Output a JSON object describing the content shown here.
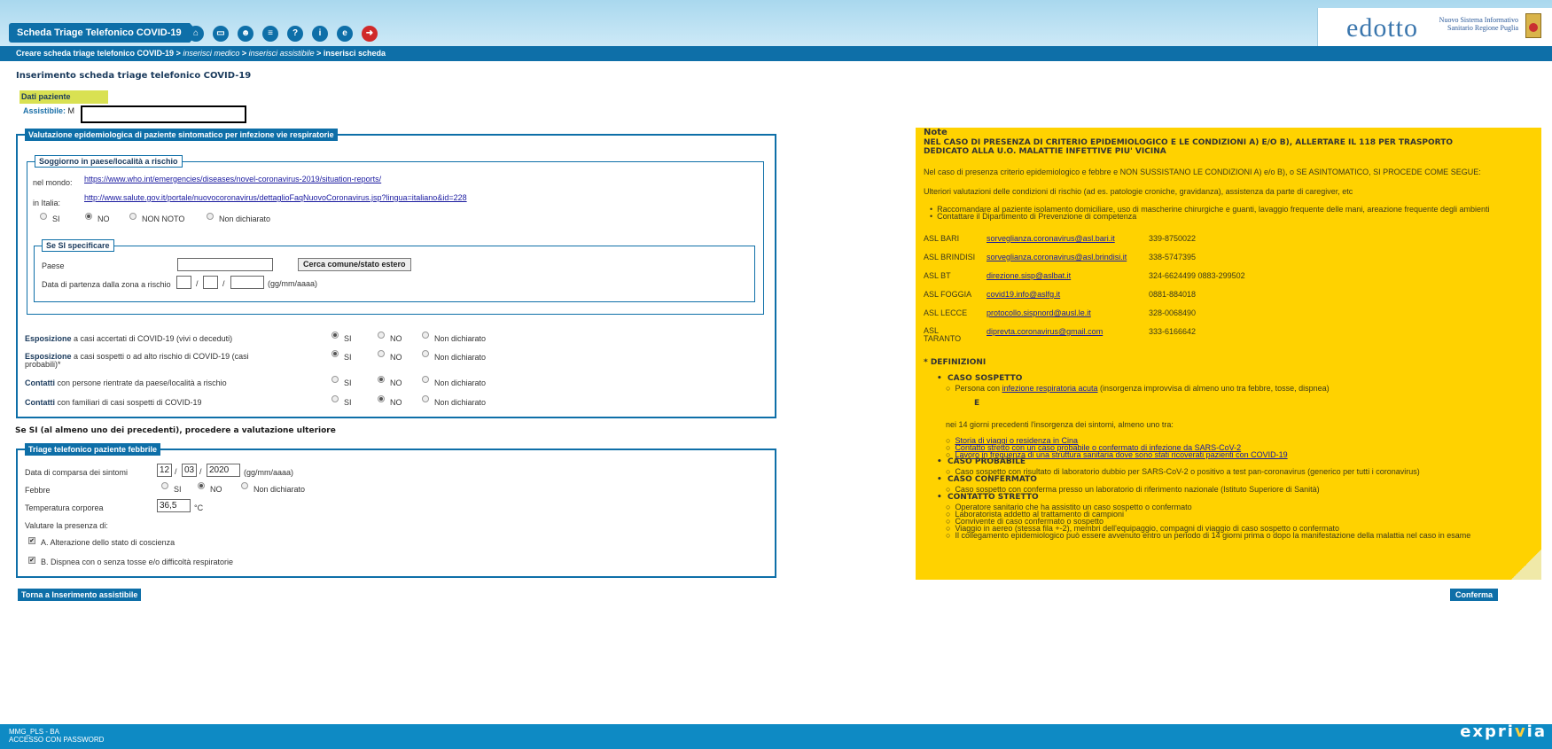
{
  "header": {
    "app_title": "Scheda Triage Telefonico COVID-19",
    "nav_icons": [
      "home-icon",
      "folder-icon",
      "users-icon",
      "document-icon",
      "help-icon",
      "info-icon",
      "sheet-icon",
      "exit-icon"
    ],
    "logo": "edotto",
    "regione": "Nuovo Sistema Informativo Sanitario Regione Puglia"
  },
  "breadcrumb": {
    "item1": "Creare scheda triage telefonico COVID-19",
    "item2": "inserisci medico",
    "item3": "inserisci assistibile",
    "item4": "inserisci scheda",
    "sep": " > "
  },
  "page_title": "Inserimento scheda triage telefonico COVID-19",
  "dati": {
    "title": "Dati paziente",
    "assistibile_label": "Assistibile:",
    "assistibile_value": "M"
  },
  "valutazione": {
    "title": "Valutazione epidemiologica di paziente sintomatico per infezione vie respiratorie",
    "soggiorno": {
      "title": "Soggiorno in paese/località a rischio",
      "nel_mondo": "nel mondo:",
      "link_mondo": "https://www.who.int/emergencies/diseases/novel-coronavirus-2019/situation-reports/",
      "in_italia": "in Italia:",
      "link_italia": "http://www.salute.gov.it/portale/nuovocoronavirus/dettaglioFaqNuovoCoronavirus.jsp?lingua=italiano&id=228",
      "opt_si": "SI",
      "opt_no": "NO",
      "opt_non_noto": "NON NOTO",
      "opt_non_dich": "Non dichiarato"
    },
    "se_si": {
      "title": "Se SI specificare",
      "paese": "Paese",
      "cerca": "Cerca comune/stato estero",
      "data_partenza": "Data di partenza dalla zona a rischio",
      "date_fmt": "(gg/mm/aaaa)",
      "sep": "/"
    },
    "rows": [
      {
        "bold": "Esposizione",
        "text": " a casi accertati di COVID-19 (vivi o deceduti)"
      },
      {
        "bold": "Esposizione",
        "text": " a casi sospetti o ad alto rischio di COVID-19 (casi",
        "text2": "probabili)*"
      },
      {
        "bold": "Contatti",
        "text": " con persone rientrate da paese/località a rischio"
      },
      {
        "bold": "Contatti",
        "text": " con familiari di casi sospetti di COVID-19"
      }
    ],
    "opt_si": "SI",
    "opt_no": "NO",
    "opt_non_dich": "Non dichiarato"
  },
  "se_si_note": "Se SI (al almeno uno dei precedenti), procedere a valutazione ulteriore",
  "triage": {
    "title": "Triage telefonico paziente febbrile",
    "data_comparsa": "Data di comparsa dei sintomi",
    "day": "12",
    "month": "03",
    "year": "2020",
    "date_fmt": "(gg/mm/aaaa)",
    "febbre": "Febbre",
    "opt_si": "SI",
    "opt_no": "NO",
    "opt_non_dich": "Non dichiarato",
    "temp_label": "Temperatura corporea",
    "temp_value": "36,5",
    "temp_unit": "°C",
    "valutare": "Valutare la presenza di:",
    "check_a": "A. Alterazione dello stato di coscienza",
    "check_b": "B. Dispnea con o senza tosse e/o difficoltà respiratorie"
  },
  "buttons": {
    "torna": "Torna a Inserimento assistibile",
    "conferma": "Conferma"
  },
  "notes": {
    "title": "Note",
    "alert1": "NEL CASO DI PRESENZA DI CRITERIO EPIDEMIOLOGICO E LE CONDIZIONI A) E/O B), ALLERTARE IL 118 PER TRASPORTO",
    "alert2": "DEDICATO ALLA U.O. MALATTIE INFETTIVE PIU' VICINA",
    "line1": "Nel caso di presenza criterio epidemiologico e febbre e NON SUSSISTANO LE CONDIZIONI A) e/o B), o SE ASINTOMATICO, SI PROCEDE COME SEGUE:",
    "line2": "Ulteriori valutazioni delle condizioni di rischio (ad es. patologie croniche, gravidanza), assistenza da parte di caregiver, etc",
    "bullet1": "Raccomandare al paziente isolamento domiciliare, uso di mascherine chirurgiche e guanti, lavaggio frequente delle mani, areazione frequente degli ambienti",
    "bullet2": "Contattare il Dipartimento di Prevenzione di competenza",
    "asl": [
      {
        "name": "ASL BARI",
        "email": "sorveglianza.coronavirus@asl.bari.it",
        "phone": "339-8750022"
      },
      {
        "name": "ASL BRINDISI",
        "email": "sorveglianza.coronavirus@asl.brindisi.it",
        "phone": "338-5747395"
      },
      {
        "name": "ASL BT",
        "email": "direzione.sisp@aslbat.it",
        "phone": "324-6624499 0883-299502"
      },
      {
        "name": "ASL FOGGIA",
        "email": "covid19.info@aslfg.it",
        "phone": "0881-884018"
      },
      {
        "name": "ASL LECCE",
        "email": "protocollo.sispnord@ausl.le.it",
        "phone": "328-0068490"
      },
      {
        "name": "ASL",
        "name2": "TARANTO",
        "email": "diprevta.coronavirus@gmail.com",
        "phone": "333-6166642"
      }
    ],
    "def_title": "* DEFINIZIONI",
    "caso_sospetto": "CASO SOSPETTO",
    "cs1a": "Persona con ",
    "cs1link": "infezione respiratoria acuta",
    "cs1b": " (insorgenza improvvisa di almeno uno tra febbre, tosse, dispnea)",
    "cs_e": "E",
    "cs2": "nei 14 giorni precedenti l'insorgenza dei sintomi, almeno uno tra:",
    "cs_a": "Storia di viaggi o residenza in Cina",
    "cs_b": "Contatto stretto con un caso probabile o confermato di infezione da SARS-CoV-2",
    "cs_c": "Lavoro in frequenza di una struttura sanitaria dove sono stati ricoverati pazienti con COVID-19",
    "caso_probabile": "CASO PROBABILE",
    "cp1": "Caso sospetto con risultato di laboratorio dubbio per SARS-CoV-2 o positivo a test pan-coronavirus (generico per tutti i coronavirus)",
    "caso_confermato": "CASO CONFERMATO",
    "cc1": "Caso sospetto con conferma presso un laboratorio di riferimento nazionale (Istituto Superiore di Sanità)",
    "contatto_stretto": "CONTATTO STRETTO",
    "ct1": "Operatore sanitario che ha assistito un caso sospetto o confermato",
    "ct2": "Laboratorista addetto al trattamento di campioni",
    "ct3": "Convivente di caso confermato o sospetto",
    "ct4": "Viaggio in aereo (stessa fila +-2), membri dell'equipaggio, compagni di viaggio di caso sospetto o confermato",
    "ct5": "Il collegamento epidemiologico può essere avvenuto entro un periodo di 14 giorni prima o dopo la manifestazione della malattia nel caso in esame"
  },
  "footer": {
    "line1": "MMG_PLS  -  BA",
    "line2": "ACCESSO CON PASSWORD",
    "brand_a": "expri",
    "brand_b": "v",
    "brand_c": "ia"
  }
}
